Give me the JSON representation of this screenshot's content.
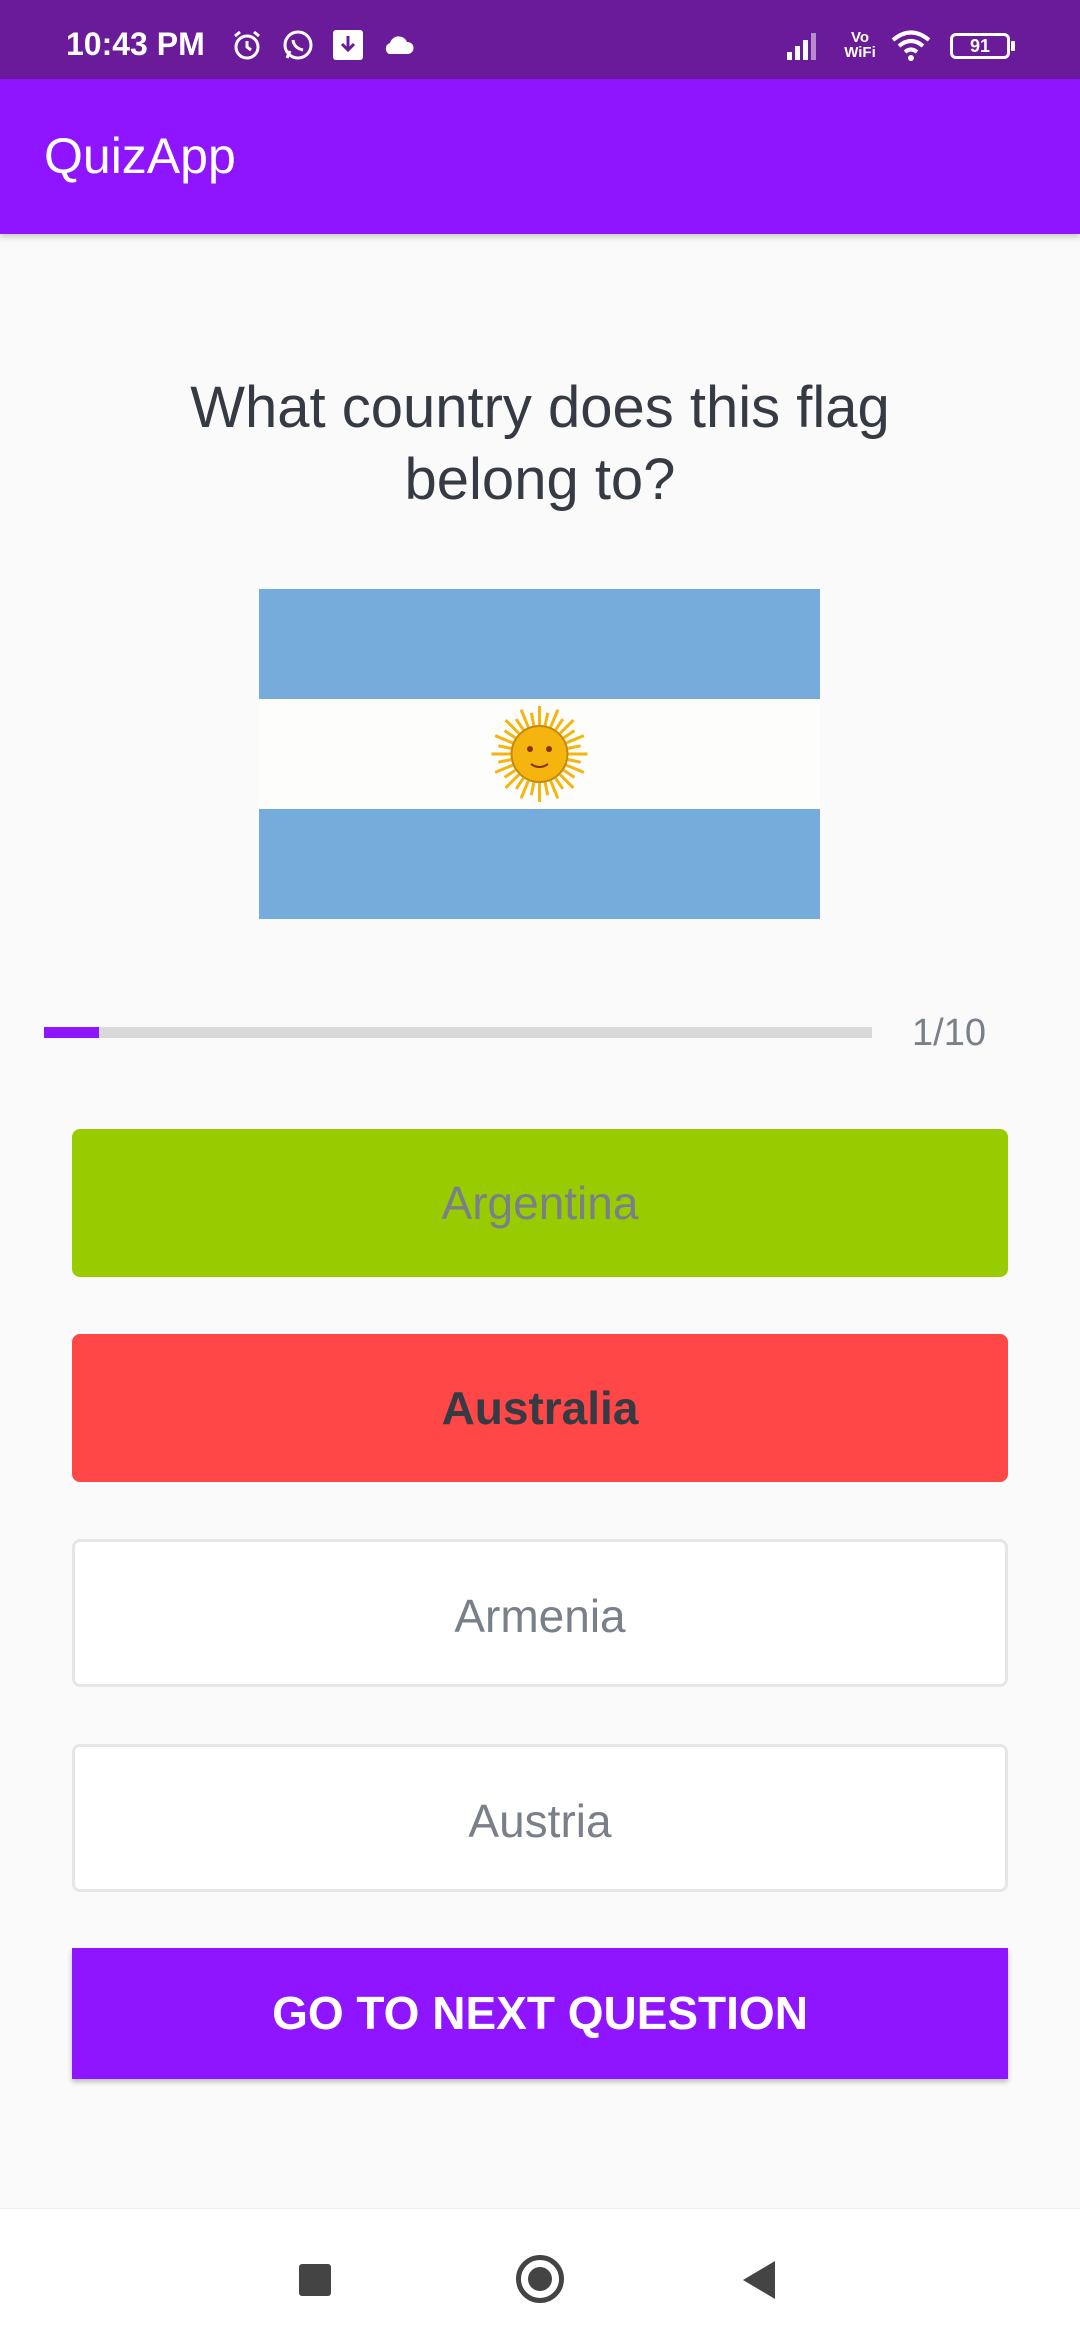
{
  "status_bar": {
    "time": "10:43 PM",
    "battery": "91",
    "icons": [
      "alarm-icon",
      "whatsapp-icon",
      "download-icon",
      "cloud-icon",
      "signal-icon",
      "vowifi-icon",
      "wifi-icon",
      "battery-icon"
    ],
    "vowifi_label_top": "Vo",
    "vowifi_label_bottom": "WiFi"
  },
  "app_bar": {
    "title": "QuizApp"
  },
  "quiz": {
    "question": "What country does this flag belong to?",
    "flag": {
      "country_icon": "argentina-flag-icon",
      "colors": {
        "stripe_blue": "#75ACDC",
        "stripe_white": "#FDFDFB",
        "sun": "#F6B40E"
      }
    },
    "progress": {
      "current": 1,
      "total": 10,
      "text": "1/10"
    },
    "options": [
      {
        "label": "Argentina",
        "state": "correct"
      },
      {
        "label": "Australia",
        "state": "wrong"
      },
      {
        "label": "Armenia",
        "state": "default"
      },
      {
        "label": "Austria",
        "state": "default"
      }
    ],
    "submit_label": "GO TO NEXT QUESTION"
  },
  "colors": {
    "status_bar": "#6A1B9A",
    "primary": "#8F14FF",
    "correct": "#99CC00",
    "wrong": "#FF4747",
    "text_dark": "#363A43",
    "text_gray": "#7A8089"
  },
  "nav_bar": {
    "icons": [
      "recents-icon",
      "home-icon",
      "back-icon"
    ]
  }
}
